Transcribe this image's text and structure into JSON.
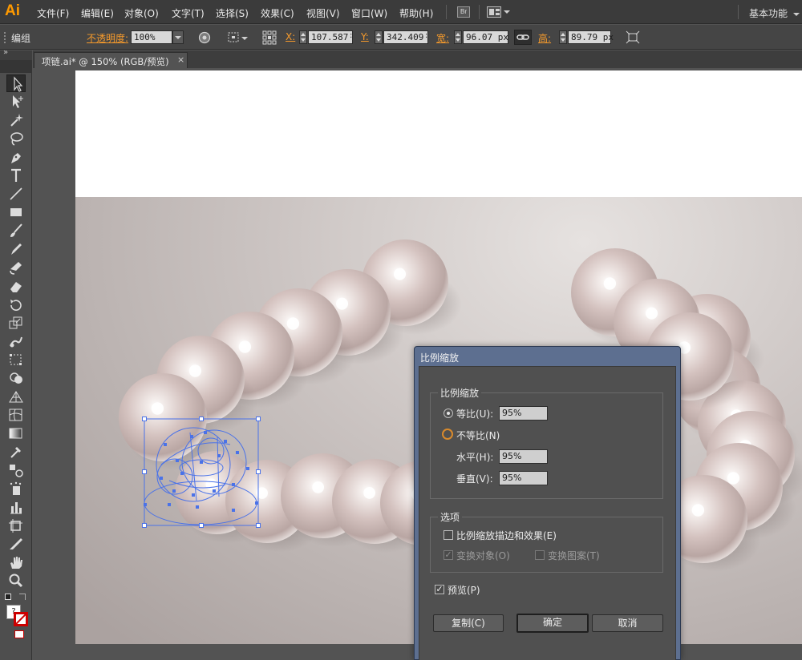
{
  "app": {
    "logo": "Ai",
    "workspace": "基本功能"
  },
  "menu": [
    "文件(F)",
    "编辑(E)",
    "对象(O)",
    "文字(T)",
    "选择(S)",
    "效果(C)",
    "视图(V)",
    "窗口(W)",
    "帮助(H)"
  ],
  "menu_icons": {
    "bridge": "Br"
  },
  "control": {
    "selection_type": "编组",
    "opacity_label": "不透明度:",
    "opacity_value": "100%",
    "x_label": "X:",
    "x_value": "107.587",
    "x_unit": ":",
    "y_label": "Y:",
    "y_value": "342.409",
    "y_unit": ":",
    "w_label": "宽:",
    "w_value": "96.07 px",
    "h_label": "高:",
    "h_value": "89.79 px"
  },
  "document_tab": {
    "title": "项链.ai* @ 150% (RGB/预览)",
    "close": "×"
  },
  "toolbox": {
    "collapse_glyph": "»",
    "default_colors": "?"
  },
  "dialog": {
    "title": "比例缩放",
    "scale_group": {
      "title": "比例缩放",
      "uniform_label": "等比(U):",
      "uniform_value": "95%",
      "nonuniform_label": "不等比(N)",
      "horizontal_label": "水平(H):",
      "horizontal_value": "95%",
      "vertical_label": "垂直(V):",
      "vertical_value": "95%",
      "selected": "uniform"
    },
    "options_group": {
      "title": "选项",
      "scale_strokes_label": "比例缩放描边和效果(E)",
      "scale_strokes_checked": false,
      "transform_objects_label": "变换对象(O)",
      "transform_objects_checked": true,
      "transform_patterns_label": "变换图案(T)",
      "transform_patterns_checked": false
    },
    "preview_label": "预览(P)",
    "preview_checked": true,
    "copy_button": "复制(C)",
    "ok_button": "确定",
    "cancel_button": "取消"
  },
  "colors": {
    "accent_orange": "#f59a2c",
    "dialog_titlebar": "#5d6f90",
    "selection_blue": "#4a72e8",
    "ui_dark": "#535353"
  }
}
